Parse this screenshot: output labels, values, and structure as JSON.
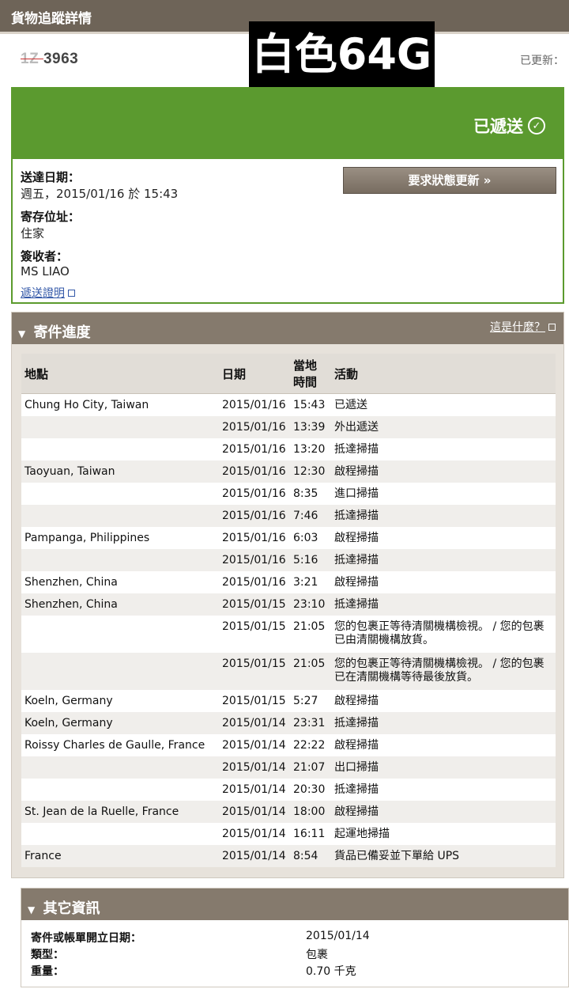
{
  "header": {
    "title": "貨物追蹤詳情"
  },
  "tracking": {
    "number_masked": "1Z   ",
    "number_suffix": "3963",
    "updated_label": "已更新："
  },
  "overlay_text": "白色64G",
  "status": {
    "label": "已遞送",
    "accent": "#5b9a2f",
    "update_button": "要求狀態更新 »",
    "fields": [
      {
        "label": "送達日期：",
        "value": "週五，2015/01/16 於 15:43"
      },
      {
        "label": "寄存位址：",
        "value": "住家"
      },
      {
        "label": "簽收者：",
        "value": "MS LIAO"
      }
    ],
    "proof_link": "遞送證明"
  },
  "progress": {
    "title": "寄件進度",
    "help_link": "這是什麼？",
    "columns": {
      "location": "地點",
      "date": "日期",
      "time": "當地時間",
      "activity": "活動"
    },
    "rows": [
      {
        "location": "Chung Ho City, Taiwan",
        "date": "2015/01/16",
        "time": "15:43",
        "activity": "已遞送"
      },
      {
        "location": "",
        "date": "2015/01/16",
        "time": "13:39",
        "activity": "外出遞送"
      },
      {
        "location": "",
        "date": "2015/01/16",
        "time": "13:20",
        "activity": "抵達掃描"
      },
      {
        "location": "Taoyuan, Taiwan",
        "date": "2015/01/16",
        "time": "12:30",
        "activity": "啟程掃描"
      },
      {
        "location": "",
        "date": "2015/01/16",
        "time": "8:35",
        "activity": "進口掃描"
      },
      {
        "location": "",
        "date": "2015/01/16",
        "time": "7:46",
        "activity": "抵達掃描"
      },
      {
        "location": "Pampanga, Philippines",
        "date": "2015/01/16",
        "time": "6:03",
        "activity": "啟程掃描"
      },
      {
        "location": "",
        "date": "2015/01/16",
        "time": "5:16",
        "activity": "抵達掃描"
      },
      {
        "location": "Shenzhen, China",
        "date": "2015/01/16",
        "time": "3:21",
        "activity": "啟程掃描"
      },
      {
        "location": "Shenzhen, China",
        "date": "2015/01/15",
        "time": "23:10",
        "activity": "抵達掃描"
      },
      {
        "location": "",
        "date": "2015/01/15",
        "time": "21:05",
        "activity": "您的包裹正等待清關機構檢視。 / 您的包裹已由清關機構放貨。"
      },
      {
        "location": "",
        "date": "2015/01/15",
        "time": "21:05",
        "activity": "您的包裹正等待清關機構檢視。 / 您的包裹已在清關機構等待最後放貨。"
      },
      {
        "location": "Koeln, Germany",
        "date": "2015/01/15",
        "time": "5:27",
        "activity": "啟程掃描"
      },
      {
        "location": "Koeln, Germany",
        "date": "2015/01/14",
        "time": "23:31",
        "activity": "抵達掃描"
      },
      {
        "location": "Roissy Charles de Gaulle, France",
        "date": "2015/01/14",
        "time": "22:22",
        "activity": "啟程掃描"
      },
      {
        "location": "",
        "date": "2015/01/14",
        "time": "21:07",
        "activity": "出口掃描"
      },
      {
        "location": "",
        "date": "2015/01/14",
        "time": "20:30",
        "activity": "抵達掃描"
      },
      {
        "location": "St. Jean de la Ruelle, France",
        "date": "2015/01/14",
        "time": "18:00",
        "activity": "啟程掃描"
      },
      {
        "location": "",
        "date": "2015/01/14",
        "time": "16:11",
        "activity": "起運地掃描"
      },
      {
        "location": "France",
        "date": "2015/01/14",
        "time": "8:54",
        "activity": "貨品已備妥並下單給 UPS"
      }
    ]
  },
  "other": {
    "title": "其它資訊",
    "rows": [
      {
        "label": "寄件或帳單開立日期：",
        "value": "2015/01/14"
      },
      {
        "label": "類型：",
        "value": "包裹"
      },
      {
        "label": "重量：",
        "value": "0.70 千克"
      }
    ]
  }
}
